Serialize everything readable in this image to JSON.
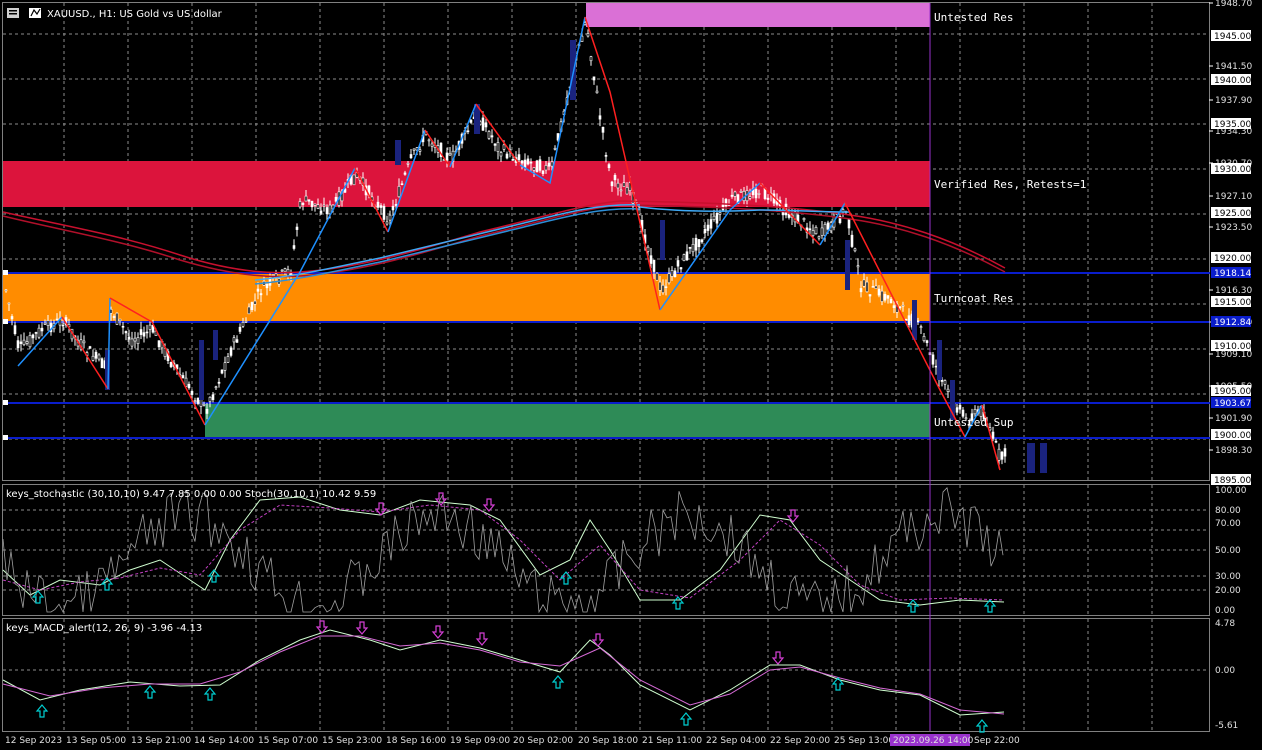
{
  "header": {
    "symbol_title": "XAUUSD., H1: US Gold vs US dollar"
  },
  "price_axis": {
    "ticks": [
      "1948.70",
      "1941.50",
      "1937.90",
      "1934.30",
      "1930.70",
      "1927.10",
      "1923.50",
      "1916.30",
      "1912.70",
      "1909.10",
      "1905.50",
      "1901.90",
      "1898.30"
    ],
    "level_boxes": [
      {
        "label": "1945.00",
        "style": "white"
      },
      {
        "label": "1940.00",
        "style": "white"
      },
      {
        "label": "1935.00",
        "style": "white"
      },
      {
        "label": "1930.00",
        "style": "white"
      },
      {
        "label": "1925.00",
        "style": "white"
      },
      {
        "label": "1920.00",
        "style": "white"
      },
      {
        "label": "1918.14",
        "style": "blue"
      },
      {
        "label": "1915.00",
        "style": "white"
      },
      {
        "label": "1912.84",
        "style": "blue"
      },
      {
        "label": "1910.00",
        "style": "white"
      },
      {
        "label": "1905.00",
        "style": "white"
      },
      {
        "label": "1903.67",
        "style": "blue"
      },
      {
        "label": "1900.00",
        "style": "white"
      },
      {
        "label": "1895.00",
        "style": "white"
      }
    ]
  },
  "zones": [
    {
      "label": "Untested Res",
      "color": "#da70d6"
    },
    {
      "label": "Verified Res, Retests=1",
      "color": "#dc143c"
    },
    {
      "label": "Turncoat Res",
      "color": "#ff8c00"
    },
    {
      "label": "Untested Sup",
      "color": "#2e8b57"
    }
  ],
  "stochastic": {
    "title": "keys_stochastic (30,10,10) 9.47 7.85 0.00 0.00 Stoch(30,10,1) 10.42 9.59",
    "ticks": [
      "100.00",
      "80.00",
      "70.00",
      "50.00",
      "30.00",
      "20.00",
      "0.00"
    ]
  },
  "macd": {
    "title": "keys_MACD_alert(12, 26, 9) -3.96 -4.13",
    "ticks": [
      "4.78",
      "0.00",
      "-5.61"
    ]
  },
  "time_axis": {
    "labels": [
      "12 Sep 2023",
      "13 Sep 05:00",
      "13 Sep 21:00",
      "14 Sep 14:00",
      "15 Sep 07:00",
      "15 Sep 23:00",
      "18 Sep 16:00",
      "19 Sep 09:00",
      "20 Sep 02:00",
      "20 Sep 18:00",
      "21 Sep 11:00",
      "22 Sep 04:00",
      "22 Sep 20:00",
      "25 Sep 13:00",
      "2023.09.26 14:00",
      "Sep 22:00"
    ]
  },
  "colors": {
    "background": "#000000",
    "grid": "#9a9a9a",
    "bull_candle": "#ffffff",
    "bear_candle": "#ffffff",
    "zigzag_up": "#1e90ff",
    "zigzag_down": "#ff2020",
    "ma_red": "#c8102e",
    "ma_blue": "#3fa9f5",
    "level_line": "#0a1dcc",
    "cursor_line": "#9932cc",
    "up_arrow": "#00ced1",
    "down_arrow": "#d43fd4"
  }
}
